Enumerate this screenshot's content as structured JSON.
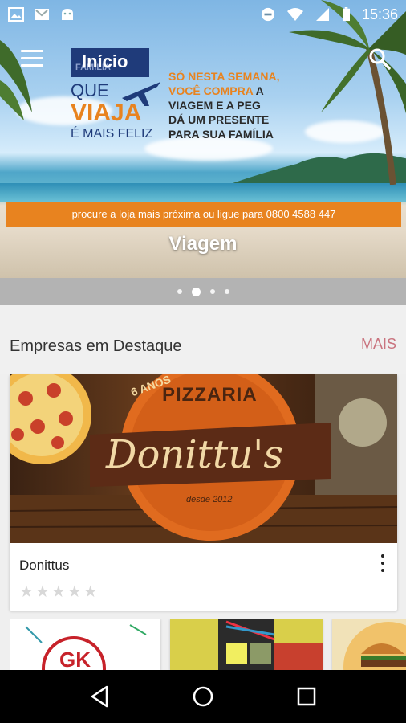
{
  "status_bar": {
    "time": "15:36",
    "icons": [
      "image-icon",
      "gmail-icon",
      "android-icon",
      "do-not-disturb-icon",
      "wifi-icon",
      "signal-icon",
      "battery-icon"
    ]
  },
  "app_bar": {
    "title": "Início",
    "menu_icon": "menu-icon",
    "search_icon": "search-icon"
  },
  "banner": {
    "ad_brand_top": "FAMÍLIA",
    "ad_que": "QUE",
    "ad_viaja": "VIAJA",
    "ad_feliz": "É MAIS FELIZ",
    "ad_line1_orange": "SÓ NESTA SEMANA,",
    "ad_line2_orange": "VOCÊ COMPRA",
    "ad_line2_rest": "A",
    "ad_line3": "VIAGEM E A PEG",
    "ad_line4": "DÁ UM PRESENTE",
    "ad_line5": "PARA SUA FAMÍLIA",
    "promo_text": "procure a loja mais próxima ou ligue para 0800 4588 447",
    "caption": "Viagem",
    "slide_count": 4,
    "active_slide": 2
  },
  "featured": {
    "section_title": "Empresas em Destaque",
    "more_label": "MAIS",
    "card": {
      "name": "Donittus",
      "image_text_top": "PIZZARIA",
      "image_text_main": "Donittu's",
      "image_text_since": "desde 2012",
      "image_badge": "6 ANOS",
      "rating": 0,
      "max_rating": 5
    },
    "thumbnails": [
      {
        "label": "GK"
      },
      {
        "label": ""
      },
      {
        "label": ""
      }
    ]
  },
  "nav_bar": {
    "back_icon": "back-icon",
    "home_icon": "home-icon",
    "recents_icon": "recents-icon"
  },
  "colors": {
    "accent_orange": "#e8831f",
    "brand_navy": "#1f3b7a",
    "more_link": "#c9737e"
  }
}
